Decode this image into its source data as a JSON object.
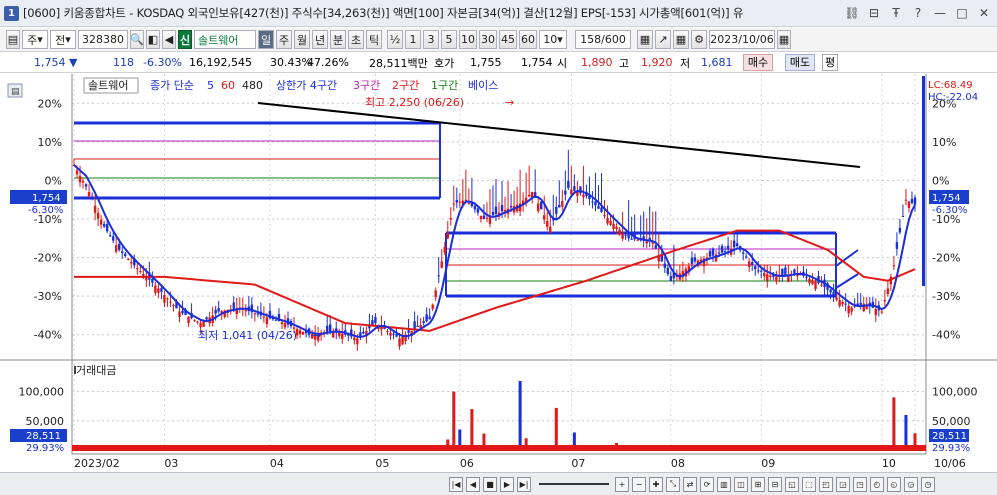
{
  "window": {
    "badge": "1",
    "title": "[0600] 키움종합차트 - KOSDAQ 외국인보유[427(천)] 주식수[34,263(천)] 액면[100] 자본금[34(억)] 결산[12월] EPS[-153] 시가총액[601(억)] 유"
  },
  "toolbar": {
    "type": "주",
    "market": "전",
    "code": "328380",
    "name": "솔트웨어",
    "periods": [
      "일",
      "주",
      "월",
      "년",
      "분",
      "초",
      "틱"
    ],
    "half": "½",
    "intervals": [
      "1",
      "3",
      "5",
      "10",
      "30",
      "45",
      "60"
    ],
    "interval_value": "10",
    "count": "158",
    "count_total": "/600",
    "date": "2023/10/06"
  },
  "info": {
    "price": "1,754",
    "change": "118",
    "change_pct": "-6.30%",
    "volume": "16,192,545",
    "turnover": "30.43%",
    "ratio2": "47.26%",
    "amount": "28,511백만",
    "quote_label": "호가",
    "quote": "1,755",
    "quote2": "1,754",
    "open_label": "시",
    "open": "1,890",
    "high_label": "고",
    "high": "1,920",
    "low_label": "저",
    "low": "1,681",
    "buy": "매수",
    "sell": "매도",
    "eval": "평"
  },
  "legend": {
    "name": "솔트웨어",
    "ma_label": "종가 단순",
    "ma5": "5",
    "ma60": "60",
    "ma480": "480",
    "z4": "상한가 4구간",
    "z3": "3구간",
    "z2": "2구간",
    "z1": "1구간",
    "base": "베이스"
  },
  "annotations": {
    "high": "최고 2,250 (06/26)",
    "low": "최저 1,041 (04/26)",
    "lc": "LC:68.49",
    "hc": "HC:-22.04"
  },
  "price_axis": {
    "ticks": [
      "20%",
      "10%",
      "0%",
      "-10%",
      "-20%",
      "-30%",
      "-40%"
    ],
    "tag_price": "1,754",
    "tag_pct": "-6.30%"
  },
  "volume_panel": {
    "title": "거래대금",
    "ticks": [
      "100,000",
      "50,000"
    ],
    "tag_value": "28,511",
    "tag_pct": "29.93%"
  },
  "x_axis": {
    "labels": [
      "2023/02",
      "03",
      "04",
      "05",
      "06",
      "07",
      "08",
      "09",
      "10",
      "10/06"
    ]
  },
  "colors": {
    "up": "#e01818",
    "down": "#1a2fd8",
    "ma60": "#e01818",
    "ma5": "#1a2fd8",
    "trend": "#000000",
    "tag_bg": "#1a3fcc"
  },
  "chart_data": {
    "type": "candlestick",
    "x_range": [
      "2023-02-01",
      "2023-10-06"
    ],
    "y_unit": "%",
    "ylim": [
      -45,
      25
    ],
    "series": [
      {
        "name": "종가",
        "points": [
          [
            0,
            4
          ],
          [
            5,
            -3
          ],
          [
            10,
            -12
          ],
          [
            15,
            -18
          ],
          [
            20,
            -22
          ],
          [
            28,
            -28
          ],
          [
            35,
            -34
          ],
          [
            42,
            -37
          ],
          [
            48,
            -34
          ],
          [
            55,
            -33
          ],
          [
            62,
            -35
          ],
          [
            70,
            -37
          ],
          [
            78,
            -40
          ],
          [
            86,
            -39
          ],
          [
            94,
            -41
          ],
          [
            100,
            -37
          ],
          [
            108,
            -41
          ],
          [
            118,
            -36
          ],
          [
            126,
            -6
          ],
          [
            130,
            -5
          ],
          [
            136,
            -10
          ],
          [
            142,
            -8
          ],
          [
            148,
            -6
          ],
          [
            152,
            -3
          ],
          [
            158,
            -12
          ],
          [
            164,
            -2
          ],
          [
            170,
            -4
          ],
          [
            176,
            -9
          ],
          [
            184,
            -15
          ],
          [
            192,
            -16
          ],
          [
            198,
            -26
          ],
          [
            206,
            -21
          ],
          [
            214,
            -19
          ],
          [
            220,
            -17
          ],
          [
            226,
            -23
          ],
          [
            232,
            -25
          ],
          [
            240,
            -24
          ],
          [
            248,
            -27
          ],
          [
            254,
            -31
          ],
          [
            258,
            -33
          ],
          [
            262,
            -32
          ],
          [
            268,
            -34
          ],
          [
            272,
            -22
          ],
          [
            276,
            -5
          ],
          [
            279,
            -6.3
          ]
        ]
      },
      {
        "name": "MA60",
        "points": [
          [
            0,
            -25
          ],
          [
            30,
            -25
          ],
          [
            60,
            -27
          ],
          [
            90,
            -37
          ],
          [
            118,
            -39
          ],
          [
            140,
            -33
          ],
          [
            170,
            -26
          ],
          [
            200,
            -18
          ],
          [
            220,
            -13
          ],
          [
            234,
            -13
          ],
          [
            250,
            -18
          ],
          [
            262,
            -25
          ],
          [
            270,
            -26
          ],
          [
            279,
            -23
          ]
        ]
      }
    ],
    "volume": {
      "unit": "백만",
      "ylim": [
        0,
        130000
      ],
      "spikes": [
        [
          124,
          18000
        ],
        [
          126,
          100000
        ],
        [
          128,
          35000
        ],
        [
          132,
          70000
        ],
        [
          136,
          28000
        ],
        [
          148,
          118000
        ],
        [
          150,
          20000
        ],
        [
          160,
          72000
        ],
        [
          166,
          30000
        ],
        [
          180,
          12000
        ],
        [
          272,
          90000
        ],
        [
          276,
          60000
        ],
        [
          279,
          28511
        ]
      ]
    }
  }
}
